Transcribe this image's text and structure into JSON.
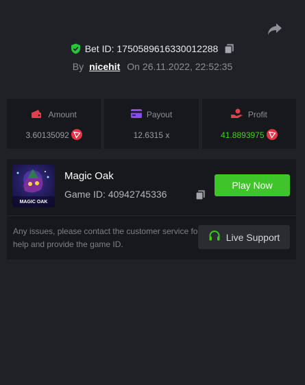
{
  "bet": {
    "id_label": "Bet ID:",
    "id_value": "1750589616330012288",
    "by_label": "By",
    "username": "nicehit",
    "on_label": "On",
    "datetime": "26.11.2022, 22:52:35"
  },
  "stats": [
    {
      "label": "Amount",
      "value": "3.60135092",
      "icon": "wallet-icon"
    },
    {
      "label": "Payout",
      "value": "12.6315 x",
      "icon": "card-icon"
    },
    {
      "label": "Profit",
      "value": "41.8893975",
      "icon": "hand-coin-icon"
    }
  ],
  "game": {
    "name": "Magic Oak",
    "id_label": "Game ID:",
    "id_value": "40942745336",
    "thumb_title": "MAGIC OAK",
    "play_label": "Play Now"
  },
  "support": {
    "notice": "Any issues, please contact the customer service for help and provide the game ID.",
    "button_label": "Live Support"
  },
  "colors": {
    "accent_green": "#3fc52a",
    "profit_green": "#42d21e",
    "shield_green": "#29c43b",
    "tron_red": "#e83245",
    "stat_icon_red": "#e0404e",
    "stat_icon_purple": "#8a4cf0"
  }
}
